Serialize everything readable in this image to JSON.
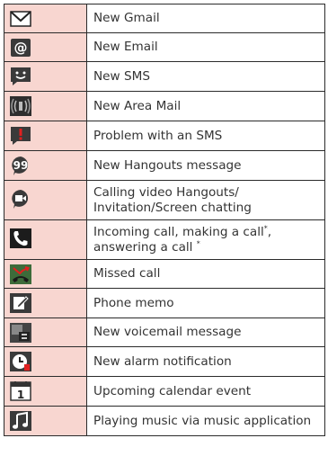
{
  "rows": [
    {
      "icon": "gmail-icon",
      "text": "New Gmail"
    },
    {
      "icon": "email-icon",
      "text": "New Email"
    },
    {
      "icon": "sms-icon",
      "text": "New SMS"
    },
    {
      "icon": "area-mail-icon",
      "text": "New Area Mail"
    },
    {
      "icon": "sms-problem-icon",
      "text": "Problem with an SMS"
    },
    {
      "icon": "hangouts-icon",
      "text": "New Hangouts message"
    },
    {
      "icon": "hangouts-video-icon",
      "lines": [
        "Calling video Hangouts/",
        "Invitation/Screen chatting"
      ]
    },
    {
      "icon": "incoming-call-icon",
      "lines": [
        "Incoming call, making a call",
        "answering a call"
      ],
      "line1_suffix": ",",
      "note": "*"
    },
    {
      "icon": "missed-call-icon",
      "text": "Missed call"
    },
    {
      "icon": "phone-memo-icon",
      "text": "Phone memo"
    },
    {
      "icon": "voicemail-icon",
      "text": "New voicemail message"
    },
    {
      "icon": "alarm-icon",
      "text": "New alarm notification"
    },
    {
      "icon": "calendar-icon",
      "text": "Upcoming calendar event",
      "calendar_day": "1"
    },
    {
      "icon": "music-icon",
      "text": "Playing music via music application"
    }
  ]
}
